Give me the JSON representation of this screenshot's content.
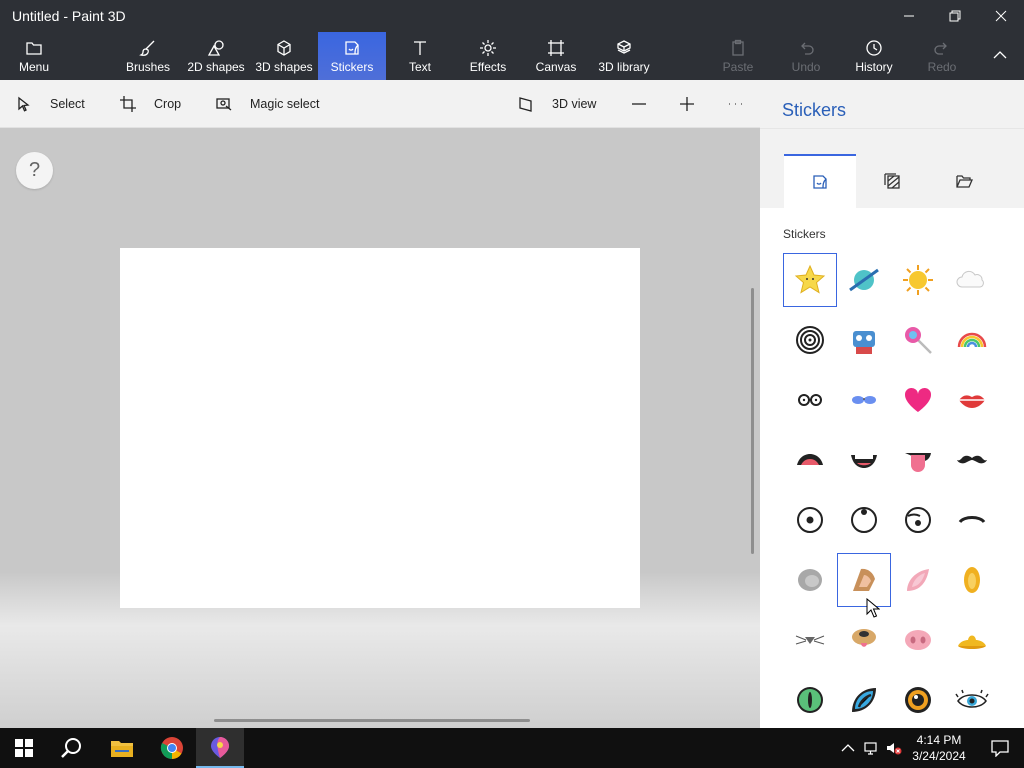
{
  "window": {
    "title": "Untitled - Paint 3D"
  },
  "ribbon": {
    "menu": "Menu",
    "brushes": "Brushes",
    "shapes2d": "2D shapes",
    "shapes3d": "3D shapes",
    "stickers": "Stickers",
    "text": "Text",
    "effects": "Effects",
    "canvas": "Canvas",
    "library3d": "3D library",
    "paste": "Paste",
    "undo": "Undo",
    "history": "History",
    "redo": "Redo"
  },
  "toolbar": {
    "select": "Select",
    "crop": "Crop",
    "magic_select": "Magic select",
    "view3d": "3D view"
  },
  "help": {
    "label": "?"
  },
  "panel": {
    "title": "Stickers",
    "section_label": "Stickers",
    "stickers": [
      [
        "star-sticker",
        "planet-sticker",
        "sun-sticker",
        "cloud-sticker"
      ],
      [
        "spiral-sticker",
        "robot-sticker",
        "lollipop-sticker",
        "rainbow-sticker"
      ],
      [
        "glasses-sticker",
        "sunglasses-sticker",
        "heart-sticker",
        "lips-sticker"
      ],
      [
        "open-mouth-sticker",
        "grin-sticker",
        "tongue-sticker",
        "mustache-sticker"
      ],
      [
        "eye-sticker",
        "eye-up-sticker",
        "eye-sad-sticker",
        "closed-eye-sticker"
      ],
      [
        "gray-ear-sticker",
        "dog-ear-sticker",
        "pink-ear-sticker",
        "yellow-ear-sticker"
      ],
      [
        "whisker-nose-sticker",
        "dog-nose-sticker",
        "pig-nose-sticker",
        "duck-beak-sticker"
      ],
      [
        "green-cat-eye-sticker",
        "blue-cat-eye-sticker",
        "orange-eye-sticker",
        "lashed-eye-sticker"
      ]
    ]
  },
  "taskbar": {
    "time": "4:14 PM",
    "date": "3/24/2024"
  },
  "colors": {
    "accent": "#3a66e0",
    "titlebar": "#2d3036",
    "panel_title": "#2a5fb8"
  }
}
